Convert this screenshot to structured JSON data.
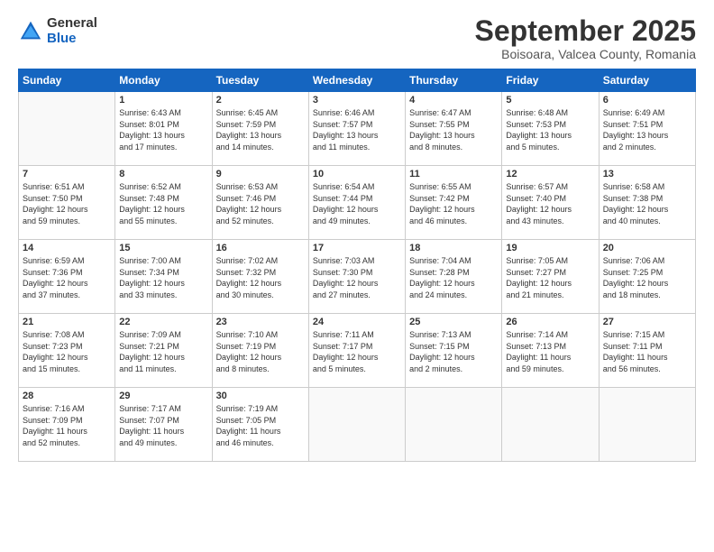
{
  "logo": {
    "general": "General",
    "blue": "Blue"
  },
  "header": {
    "month": "September 2025",
    "location": "Boisoara, Valcea County, Romania"
  },
  "weekdays": [
    "Sunday",
    "Monday",
    "Tuesday",
    "Wednesday",
    "Thursday",
    "Friday",
    "Saturday"
  ],
  "weeks": [
    [
      {
        "day": "",
        "info": ""
      },
      {
        "day": "1",
        "info": "Sunrise: 6:43 AM\nSunset: 8:01 PM\nDaylight: 13 hours\nand 17 minutes."
      },
      {
        "day": "2",
        "info": "Sunrise: 6:45 AM\nSunset: 7:59 PM\nDaylight: 13 hours\nand 14 minutes."
      },
      {
        "day": "3",
        "info": "Sunrise: 6:46 AM\nSunset: 7:57 PM\nDaylight: 13 hours\nand 11 minutes."
      },
      {
        "day": "4",
        "info": "Sunrise: 6:47 AM\nSunset: 7:55 PM\nDaylight: 13 hours\nand 8 minutes."
      },
      {
        "day": "5",
        "info": "Sunrise: 6:48 AM\nSunset: 7:53 PM\nDaylight: 13 hours\nand 5 minutes."
      },
      {
        "day": "6",
        "info": "Sunrise: 6:49 AM\nSunset: 7:51 PM\nDaylight: 13 hours\nand 2 minutes."
      }
    ],
    [
      {
        "day": "7",
        "info": "Sunrise: 6:51 AM\nSunset: 7:50 PM\nDaylight: 12 hours\nand 59 minutes."
      },
      {
        "day": "8",
        "info": "Sunrise: 6:52 AM\nSunset: 7:48 PM\nDaylight: 12 hours\nand 55 minutes."
      },
      {
        "day": "9",
        "info": "Sunrise: 6:53 AM\nSunset: 7:46 PM\nDaylight: 12 hours\nand 52 minutes."
      },
      {
        "day": "10",
        "info": "Sunrise: 6:54 AM\nSunset: 7:44 PM\nDaylight: 12 hours\nand 49 minutes."
      },
      {
        "day": "11",
        "info": "Sunrise: 6:55 AM\nSunset: 7:42 PM\nDaylight: 12 hours\nand 46 minutes."
      },
      {
        "day": "12",
        "info": "Sunrise: 6:57 AM\nSunset: 7:40 PM\nDaylight: 12 hours\nand 43 minutes."
      },
      {
        "day": "13",
        "info": "Sunrise: 6:58 AM\nSunset: 7:38 PM\nDaylight: 12 hours\nand 40 minutes."
      }
    ],
    [
      {
        "day": "14",
        "info": "Sunrise: 6:59 AM\nSunset: 7:36 PM\nDaylight: 12 hours\nand 37 minutes."
      },
      {
        "day": "15",
        "info": "Sunrise: 7:00 AM\nSunset: 7:34 PM\nDaylight: 12 hours\nand 33 minutes."
      },
      {
        "day": "16",
        "info": "Sunrise: 7:02 AM\nSunset: 7:32 PM\nDaylight: 12 hours\nand 30 minutes."
      },
      {
        "day": "17",
        "info": "Sunrise: 7:03 AM\nSunset: 7:30 PM\nDaylight: 12 hours\nand 27 minutes."
      },
      {
        "day": "18",
        "info": "Sunrise: 7:04 AM\nSunset: 7:28 PM\nDaylight: 12 hours\nand 24 minutes."
      },
      {
        "day": "19",
        "info": "Sunrise: 7:05 AM\nSunset: 7:27 PM\nDaylight: 12 hours\nand 21 minutes."
      },
      {
        "day": "20",
        "info": "Sunrise: 7:06 AM\nSunset: 7:25 PM\nDaylight: 12 hours\nand 18 minutes."
      }
    ],
    [
      {
        "day": "21",
        "info": "Sunrise: 7:08 AM\nSunset: 7:23 PM\nDaylight: 12 hours\nand 15 minutes."
      },
      {
        "day": "22",
        "info": "Sunrise: 7:09 AM\nSunset: 7:21 PM\nDaylight: 12 hours\nand 11 minutes."
      },
      {
        "day": "23",
        "info": "Sunrise: 7:10 AM\nSunset: 7:19 PM\nDaylight: 12 hours\nand 8 minutes."
      },
      {
        "day": "24",
        "info": "Sunrise: 7:11 AM\nSunset: 7:17 PM\nDaylight: 12 hours\nand 5 minutes."
      },
      {
        "day": "25",
        "info": "Sunrise: 7:13 AM\nSunset: 7:15 PM\nDaylight: 12 hours\nand 2 minutes."
      },
      {
        "day": "26",
        "info": "Sunrise: 7:14 AM\nSunset: 7:13 PM\nDaylight: 11 hours\nand 59 minutes."
      },
      {
        "day": "27",
        "info": "Sunrise: 7:15 AM\nSunset: 7:11 PM\nDaylight: 11 hours\nand 56 minutes."
      }
    ],
    [
      {
        "day": "28",
        "info": "Sunrise: 7:16 AM\nSunset: 7:09 PM\nDaylight: 11 hours\nand 52 minutes."
      },
      {
        "day": "29",
        "info": "Sunrise: 7:17 AM\nSunset: 7:07 PM\nDaylight: 11 hours\nand 49 minutes."
      },
      {
        "day": "30",
        "info": "Sunrise: 7:19 AM\nSunset: 7:05 PM\nDaylight: 11 hours\nand 46 minutes."
      },
      {
        "day": "",
        "info": ""
      },
      {
        "day": "",
        "info": ""
      },
      {
        "day": "",
        "info": ""
      },
      {
        "day": "",
        "info": ""
      }
    ]
  ]
}
